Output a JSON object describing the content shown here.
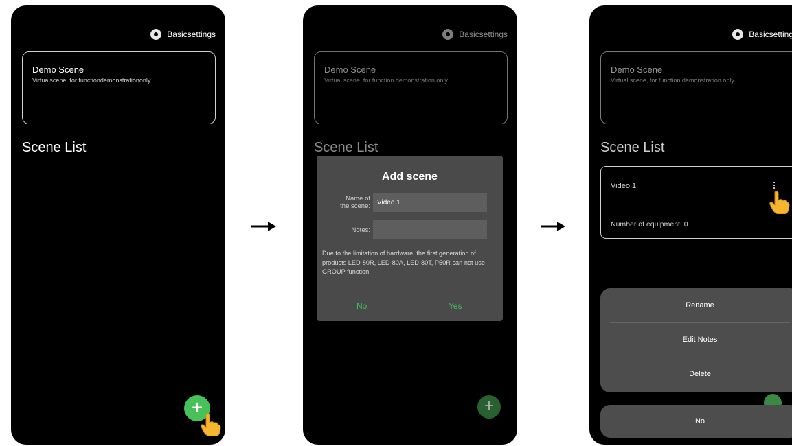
{
  "screen1": {
    "settings_label": "Basicsettings",
    "demo_title": "Demo Scene",
    "demo_subtitle": "Virtualscene, for functiondemonstrationonly.",
    "list_title": "Scene List",
    "fab_symbol": "+"
  },
  "screen2": {
    "settings_label": "Basicsettings",
    "demo_title": "Demo Scene",
    "demo_subtitle": "Virtual scene, for function demonstration only.",
    "list_title": "Scene List",
    "fab_symbol": "+",
    "dialog": {
      "title": "Add scene",
      "name_label_line1": "Name of",
      "name_label_line2": "the scene:",
      "name_value": "Video 1",
      "notes_label": "Notes:",
      "notes_value": "",
      "note_text": "Due to the limitation of hardware, the first generation of products LED-80R, LED-80A, LED-80T, P50R can not use GROUP function.",
      "no_label": "No",
      "yes_label": "Yes"
    }
  },
  "screen3": {
    "settings_label": "Basicsettings",
    "demo_title": "Demo Scene",
    "demo_subtitle": "Virtual scene, for function demonstration only.",
    "list_title": "Scene List",
    "scene": {
      "name": "Video 1",
      "equipment_text": "Number of equipment:  0"
    },
    "menu": [
      "Rename",
      "Edit Notes",
      "Delete"
    ],
    "no_label": "No"
  },
  "colors": {
    "phone_bg": "#000000",
    "accent_green": "#48c15a",
    "dialog_bg": "#4a4a4a",
    "sheet_bg": "#4d4d4d"
  },
  "icons": [
    "gear-icon",
    "plus-icon",
    "hand-pointer-icon",
    "arrow-right-icon",
    "more-vertical-icon"
  ]
}
